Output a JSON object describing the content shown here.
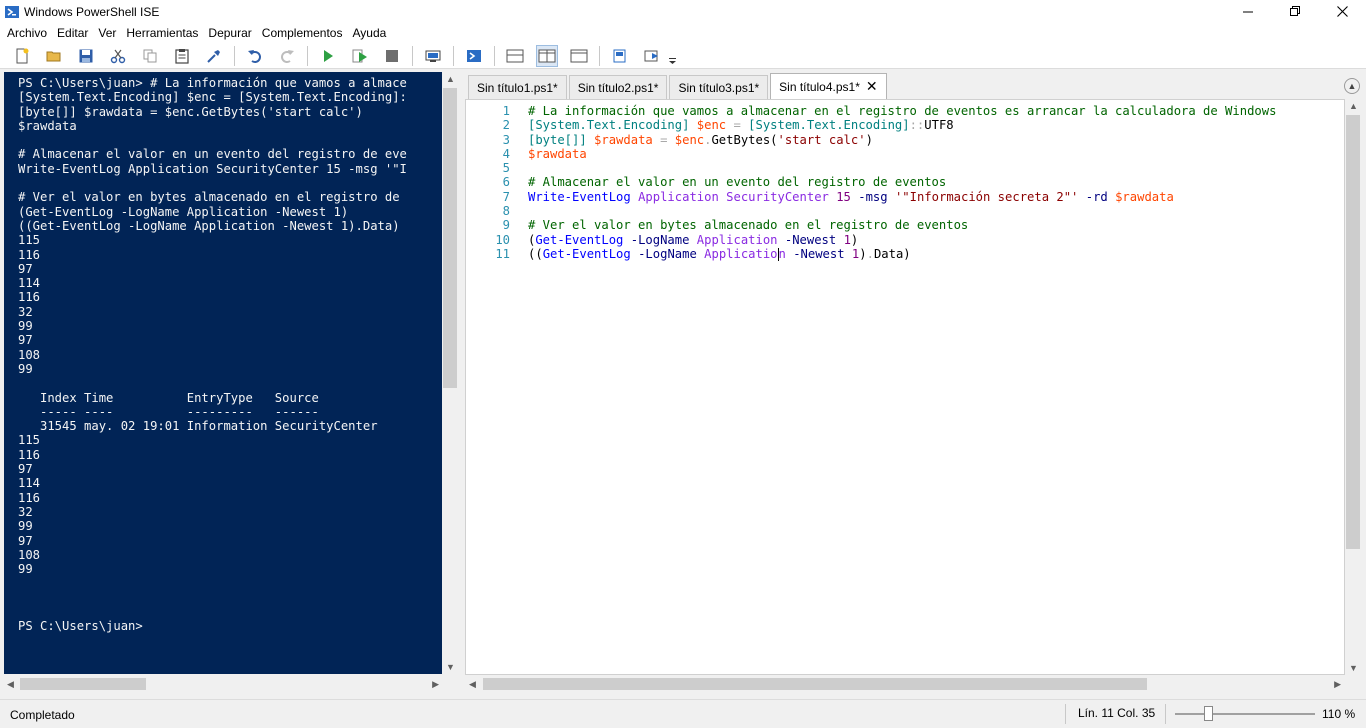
{
  "window": {
    "title": "Windows PowerShell ISE"
  },
  "menu": [
    "Archivo",
    "Editar",
    "Ver",
    "Herramientas",
    "Depurar",
    "Complementos",
    "Ayuda"
  ],
  "toolbar_icons": [
    "new-file-icon",
    "open-icon",
    "save-icon",
    "cut-icon",
    "copy-icon",
    "paste-icon",
    "clear-console-icon",
    "undo-icon",
    "redo-icon",
    "run-icon",
    "run-selection-icon",
    "stop-icon",
    "remote-powershell-icon",
    "start-powershell-icon",
    "show-script-top-icon",
    "show-script-right-icon",
    "show-script-maximized-icon",
    "show-command-window-icon",
    "show-command-addon-icon",
    "customize-toolbar-icon"
  ],
  "console": {
    "text": "PS C:\\Users\\juan> # La información que vamos a almace\n[System.Text.Encoding] $enc = [System.Text.Encoding]:\n[byte[]] $rawdata = $enc.GetBytes('start calc')\n$rawdata\n\n# Almacenar el valor en un evento del registro de eve\nWrite-EventLog Application SecurityCenter 15 -msg '\"I\n\n# Ver el valor en bytes almacenado en el registro de \n(Get-EventLog -LogName Application -Newest 1)\n((Get-EventLog -LogName Application -Newest 1).Data)\n115\n116\n97\n114\n116\n32\n99\n97\n108\n99\n\n   Index Time          EntryType   Source\n   ----- ----          ---------   ------\n   31545 may. 02 19:01 Information SecurityCenter\n115\n116\n97\n114\n116\n32\n99\n97\n108\n99\n\n\n\nPS C:\\Users\\juan>"
  },
  "tabs": [
    {
      "label": "Sin título1.ps1*",
      "active": false
    },
    {
      "label": "Sin título2.ps1*",
      "active": false
    },
    {
      "label": "Sin título3.ps1*",
      "active": false
    },
    {
      "label": "Sin título4.ps1*",
      "active": true
    }
  ],
  "tab_close": "✕",
  "editor": {
    "line_numbers": [
      "1",
      "2",
      "3",
      "4",
      "5",
      "6",
      "7",
      "8",
      "9",
      "10",
      "11"
    ],
    "lines": [
      [
        {
          "t": "# La información que vamos a almacenar en el registro de eventos es arrancar la calculadora de Windows",
          "c": "comment"
        }
      ],
      [
        {
          "t": "[System.Text.Encoding]",
          "c": "type"
        },
        {
          "t": " ",
          "c": "plain"
        },
        {
          "t": "$enc",
          "c": "var"
        },
        {
          "t": " = ",
          "c": "op"
        },
        {
          "t": "[System.Text.Encoding]",
          "c": "type"
        },
        {
          "t": "::",
          "c": "op"
        },
        {
          "t": "UTF8",
          "c": "plain"
        }
      ],
      [
        {
          "t": "[byte[]]",
          "c": "type"
        },
        {
          "t": " ",
          "c": "plain"
        },
        {
          "t": "$rawdata",
          "c": "var"
        },
        {
          "t": " = ",
          "c": "op"
        },
        {
          "t": "$enc",
          "c": "var"
        },
        {
          "t": ".",
          "c": "op"
        },
        {
          "t": "GetBytes(",
          "c": "plain"
        },
        {
          "t": "'start calc'",
          "c": "str"
        },
        {
          "t": ")",
          "c": "plain"
        }
      ],
      [
        {
          "t": "$rawdata",
          "c": "var"
        }
      ],
      [],
      [
        {
          "t": "# Almacenar el valor en un evento del registro de eventos",
          "c": "comment"
        }
      ],
      [
        {
          "t": "Write-EventLog",
          "c": "cmd"
        },
        {
          "t": " ",
          "c": "plain"
        },
        {
          "t": "Application",
          "c": "arg"
        },
        {
          "t": " ",
          "c": "plain"
        },
        {
          "t": "SecurityCenter",
          "c": "arg"
        },
        {
          "t": " ",
          "c": "plain"
        },
        {
          "t": "15",
          "c": "num"
        },
        {
          "t": " ",
          "c": "plain"
        },
        {
          "t": "-msg",
          "c": "param"
        },
        {
          "t": " ",
          "c": "plain"
        },
        {
          "t": "'\"Información secreta 2\"'",
          "c": "str"
        },
        {
          "t": " ",
          "c": "plain"
        },
        {
          "t": "-rd",
          "c": "param"
        },
        {
          "t": " ",
          "c": "plain"
        },
        {
          "t": "$rawdata",
          "c": "var"
        }
      ],
      [],
      [
        {
          "t": "# Ver el valor en bytes almacenado en el registro de eventos",
          "c": "comment"
        }
      ],
      [
        {
          "t": "(",
          "c": "plain"
        },
        {
          "t": "Get-EventLog",
          "c": "cmd"
        },
        {
          "t": " ",
          "c": "plain"
        },
        {
          "t": "-LogName",
          "c": "param"
        },
        {
          "t": " ",
          "c": "plain"
        },
        {
          "t": "Application",
          "c": "arg"
        },
        {
          "t": " ",
          "c": "plain"
        },
        {
          "t": "-Newest",
          "c": "param"
        },
        {
          "t": " ",
          "c": "plain"
        },
        {
          "t": "1",
          "c": "num"
        },
        {
          "t": ")",
          "c": "plain"
        }
      ],
      [
        {
          "t": "((",
          "c": "plain"
        },
        {
          "t": "Get-EventLog",
          "c": "cmd"
        },
        {
          "t": " ",
          "c": "plain"
        },
        {
          "t": "-LogName",
          "c": "param"
        },
        {
          "t": " ",
          "c": "plain"
        },
        {
          "t": "Applicatio",
          "c": "arg"
        },
        {
          "t": "|cursor|",
          "c": "cursor"
        },
        {
          "t": "n",
          "c": "arg"
        },
        {
          "t": " ",
          "c": "plain"
        },
        {
          "t": "-Newest",
          "c": "param"
        },
        {
          "t": " ",
          "c": "plain"
        },
        {
          "t": "1",
          "c": "num"
        },
        {
          "t": ")",
          "c": "plain"
        },
        {
          "t": ".",
          "c": "op"
        },
        {
          "t": "Data)",
          "c": "plain"
        }
      ]
    ]
  },
  "status": {
    "text": "Completado",
    "position": "Lín. 11  Col. 35",
    "zoom": "110 %",
    "zoom_level_percent": 110
  }
}
